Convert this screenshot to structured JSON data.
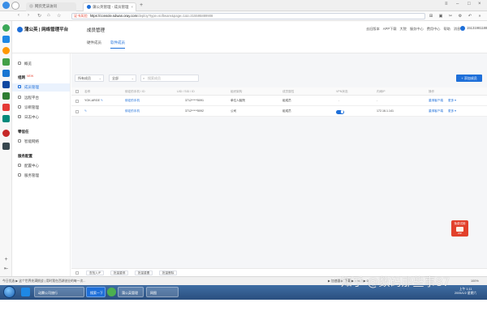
{
  "browser": {
    "tabs": [
      {
        "label": "网页无法访问",
        "active": false
      },
      {
        "label": "蒲公英管理 - 成员管理",
        "active": true
      }
    ],
    "new_tab": "+",
    "url": {
      "security_label": "证书风险",
      "domain": "https://console.sdwan.oray.com",
      "path": "/deploy?type=software&page=1&t=315595889908"
    },
    "status": {
      "left": "今日优选  ▶ 这个世界充满挑战 | 用时我在西湖创业的每一次...",
      "right": "▶ 加速器  ▶  下载  ▶  ○  ▶  □  ▶ 0",
      "zoom": "100%"
    }
  },
  "app": {
    "brand": "蒲公英 | 网络管理平台",
    "page_title": "成员管理",
    "top_links": [
      "去旧版本",
      "APP下载",
      "大院",
      "服务中心",
      "费用中心",
      "帮助",
      "消息"
    ],
    "user": "15131981188",
    "subtabs": [
      {
        "label": "硬件成员",
        "active": false
      },
      {
        "label": "软件成员",
        "active": true
      }
    ],
    "sidebar": {
      "items_top": [
        {
          "label": "概览",
          "icon": "home-icon"
        }
      ],
      "group1": {
        "label": "组网",
        "badge": "NEW"
      },
      "group1_items": [
        {
          "label": "成员管理",
          "icon": "members-icon",
          "active": true
        },
        {
          "label": "远程平台",
          "icon": "remote-icon"
        },
        {
          "label": "诊断管理",
          "icon": "diagnose-icon"
        },
        {
          "label": "日志中心",
          "icon": "log-icon"
        }
      ],
      "group2": {
        "label": "零信任"
      },
      "group2_items": [
        {
          "label": "智能网络",
          "icon": "network-icon"
        }
      ],
      "group3": {
        "label": "服务配置"
      },
      "group3_items": [
        {
          "label": "配置中心",
          "icon": "config-icon"
        },
        {
          "label": "服务管理",
          "icon": "service-icon"
        }
      ]
    },
    "filters": {
      "select1": "所有成员",
      "select2": "全部",
      "search_placeholder": "搜索成员",
      "add_button": "+ 添加成员"
    },
    "table": {
      "columns": [
        "名称",
        "绑定的手机 / ID",
        "UID / SID / ID",
        "组织架构",
        "成员属性",
        "VPN状态",
        "内网IP",
        "操作"
      ],
      "rows": [
        {
          "name": "YOK-ARGE",
          "edit_icon": "✎",
          "phone": "绑定的手机",
          "uid": "3712*****5091",
          "org": "单位人脑院",
          "attr": "组成员",
          "vpn": "-",
          "ip": "-",
          "action1": "重绑客户端",
          "action2": "更多 ▾"
        },
        {
          "name": "",
          "edit_icon": "✎",
          "phone": "绑定的手机",
          "uid": "3712*****5092",
          "org": "公司",
          "attr": "组成员",
          "vpn": "on",
          "ip": "172.16.1.141",
          "action1": "重绑客户端",
          "action2": "更多 ▾"
        }
      ]
    },
    "bottom_buttons": [
      "查找入IP",
      "批量重绑",
      "批量重置",
      "批量删除"
    ],
    "float_badge": {
      "line1": "免费试用",
      "line2": "ZIP"
    }
  },
  "taskbar": {
    "tasks": [
      "动腾公司旅行",
      "搜索一下",
      "蒲公英管理",
      "网图"
    ],
    "clock_time": "上午 1:11",
    "clock_date": "2005/1/2 星期六"
  },
  "watermark": "知乎 @数码那些事87",
  "colors": {
    "accent": "#1e6fd9",
    "danger": "#e74c3c",
    "taskbar": "#2a4f7f"
  }
}
